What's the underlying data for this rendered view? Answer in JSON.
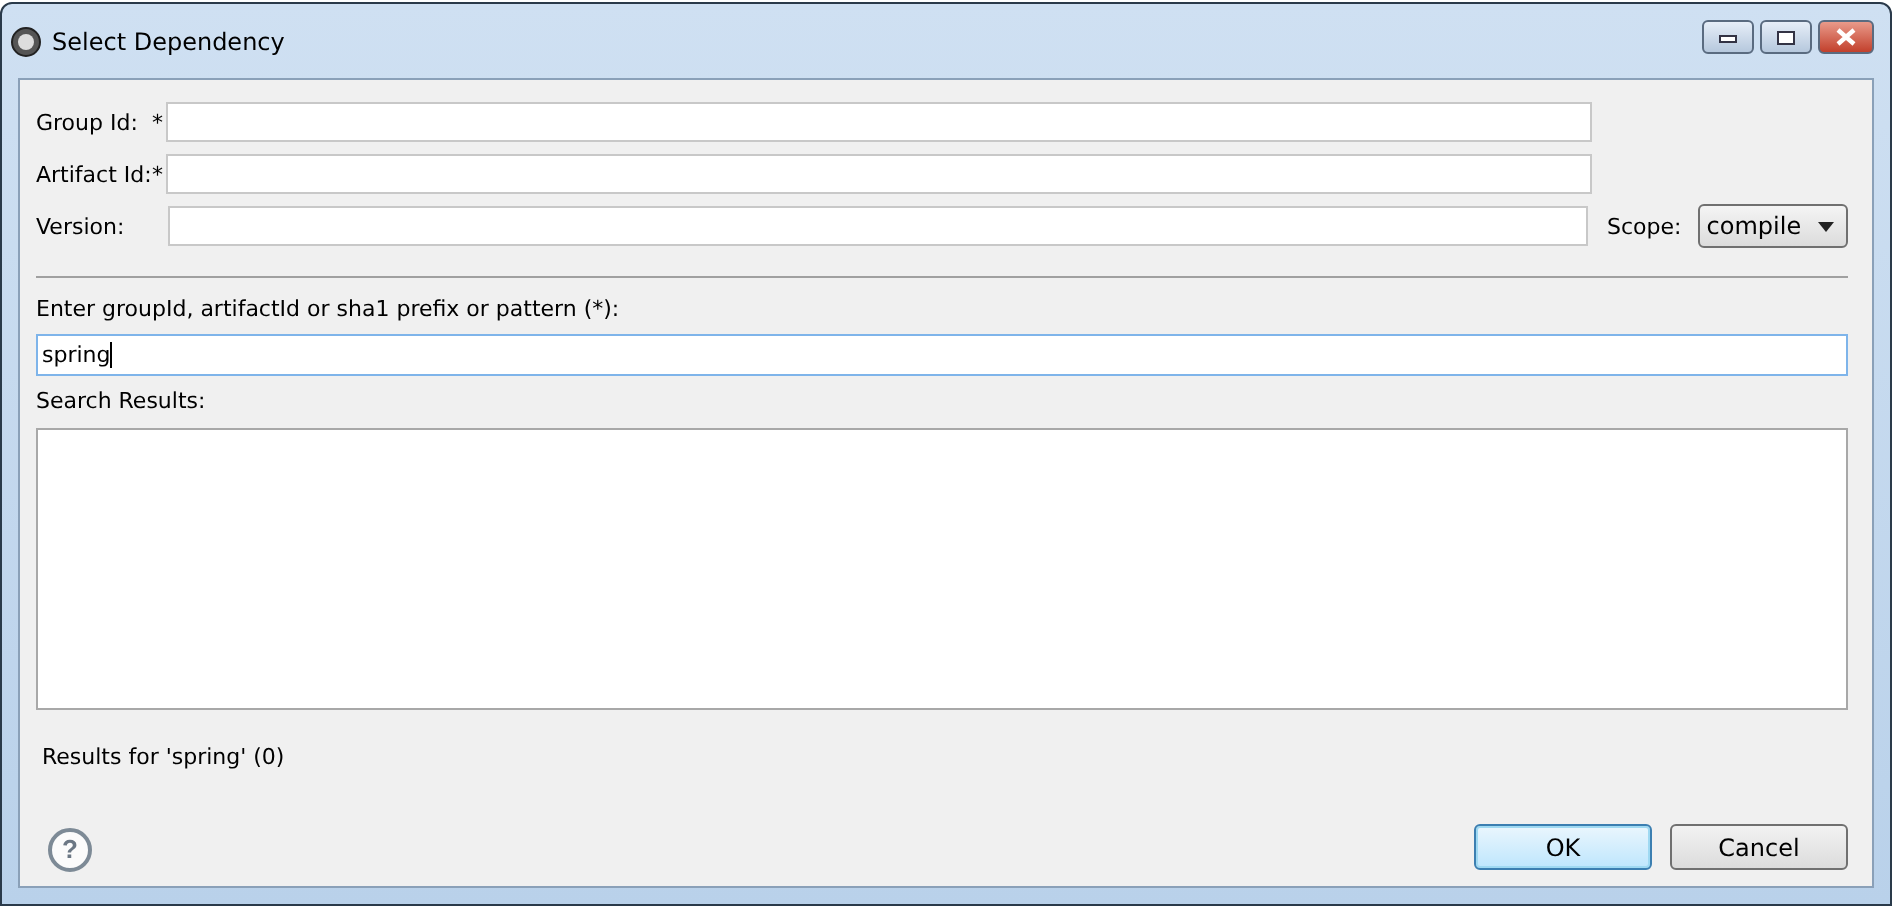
{
  "window": {
    "title": "Select Dependency"
  },
  "fields": [
    {
      "label": "Group Id:",
      "required_mark": "*"
    },
    {
      "label": "Artifact Id:",
      "required_mark": "*"
    },
    {
      "label": "Version:"
    }
  ],
  "scope": {
    "label": "Scope:",
    "value": "compile"
  },
  "search": {
    "label": "Enter groupId, artifactId or sha1 prefix or pattern (*):",
    "value": "spring"
  },
  "results": {
    "label": "Search Results:",
    "status": "Results for 'spring' (0)"
  },
  "help": {
    "label": "?"
  },
  "buttons": [
    {
      "label": "OK",
      "default": true
    },
    {
      "label": "Cancel",
      "default": false
    }
  ]
}
